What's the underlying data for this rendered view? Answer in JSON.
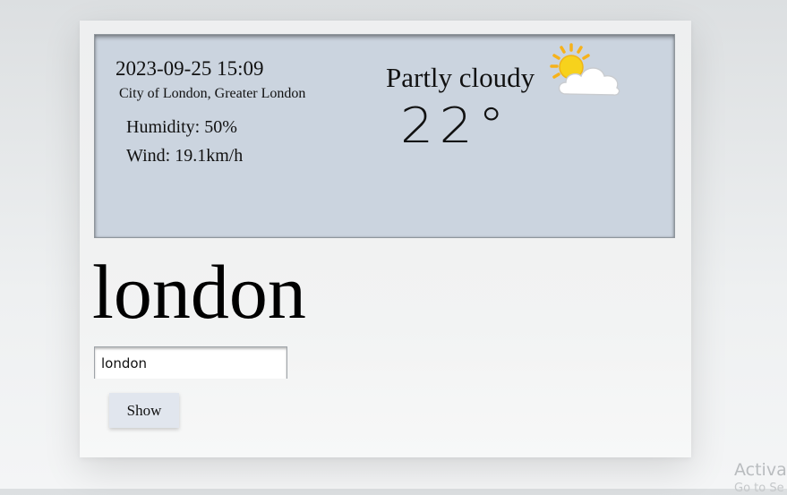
{
  "weather": {
    "datetime": "2023-09-25 15:09",
    "location": "City of London, Greater London",
    "humidity": "Humidity: 50%",
    "wind": "Wind: 19.1km/h",
    "condition": "Partly cloudy",
    "condition_icon": "partly-cloudy-icon",
    "temperature": "22°"
  },
  "city_title": "london",
  "search": {
    "value": "london"
  },
  "show_button": {
    "label": "Show"
  },
  "system_watermark": {
    "text": "Activat",
    "subtext": "Go to Se"
  },
  "colors": {
    "panel": "#cbd4df",
    "button": "#e1e6ee",
    "sun": "#f5c518",
    "cloud": "#ffffff"
  }
}
